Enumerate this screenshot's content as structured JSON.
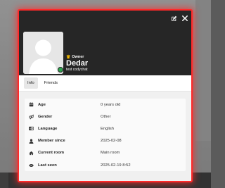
{
  "profile": {
    "role": "Owner",
    "name": "Dedar",
    "mood": "test codychat",
    "accent_color": "#ff2a2a",
    "role_icon": "crown-icon",
    "status_color": "#2ea44f"
  },
  "tabs": [
    {
      "label": "Info",
      "active": true
    },
    {
      "label": "Friends",
      "active": false
    }
  ],
  "info": [
    {
      "label": "Age",
      "value": "0 years old",
      "icon": "calendar-icon"
    },
    {
      "label": "Gender",
      "value": "Other",
      "icon": "gender-icon"
    },
    {
      "label": "Language",
      "value": "English",
      "icon": "language-icon"
    },
    {
      "label": "Member since",
      "value": "2025-02-08",
      "icon": "user-icon"
    },
    {
      "label": "Current room",
      "value": "Main room",
      "icon": "home-icon"
    },
    {
      "label": "Last seen",
      "value": "2025-02-19 8:52",
      "icon": "eye-icon"
    }
  ]
}
